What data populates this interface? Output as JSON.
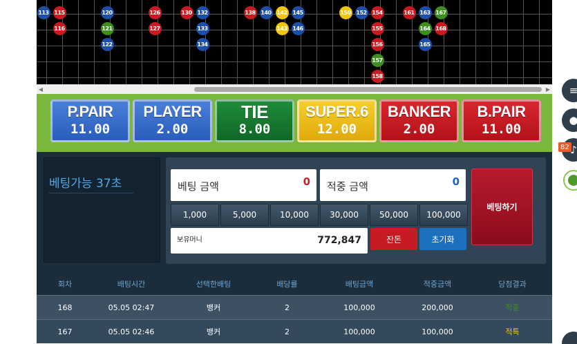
{
  "board": {
    "beads": [
      {
        "n": "113",
        "c": "B",
        "col": 0,
        "row": 0
      },
      {
        "n": "115",
        "c": "R",
        "col": 1,
        "row": 0
      },
      {
        "n": "116",
        "c": "R",
        "col": 1,
        "row": 1
      },
      {
        "n": "120",
        "c": "B",
        "col": 4,
        "row": 0
      },
      {
        "n": "121",
        "c": "G",
        "col": 4,
        "row": 1
      },
      {
        "n": "122",
        "c": "B",
        "col": 4,
        "row": 2
      },
      {
        "n": "126",
        "c": "R",
        "col": 7,
        "row": 0
      },
      {
        "n": "127",
        "c": "R",
        "col": 7,
        "row": 1
      },
      {
        "n": "130",
        "c": "R",
        "col": 9,
        "row": 0
      },
      {
        "n": "132",
        "c": "B",
        "col": 10,
        "row": 0
      },
      {
        "n": "133",
        "c": "B",
        "col": 10,
        "row": 1
      },
      {
        "n": "134",
        "c": "B",
        "col": 10,
        "row": 2
      },
      {
        "n": "138",
        "c": "R",
        "col": 13,
        "row": 0
      },
      {
        "n": "140",
        "c": "B",
        "col": 14,
        "row": 0
      },
      {
        "n": "142",
        "c": "Y",
        "col": 15,
        "row": 0
      },
      {
        "n": "143",
        "c": "Y",
        "col": 15,
        "row": 1
      },
      {
        "n": "145",
        "c": "B",
        "col": 16,
        "row": 0
      },
      {
        "n": "146",
        "c": "B",
        "col": 16,
        "row": 1
      },
      {
        "n": "150",
        "c": "Y",
        "col": 19,
        "row": 0
      },
      {
        "n": "152",
        "c": "B",
        "col": 20,
        "row": 0
      },
      {
        "n": "154",
        "c": "R",
        "col": 21,
        "row": 0
      },
      {
        "n": "155",
        "c": "R",
        "col": 21,
        "row": 1
      },
      {
        "n": "156",
        "c": "R",
        "col": 21,
        "row": 2
      },
      {
        "n": "157",
        "c": "G",
        "col": 21,
        "row": 3
      },
      {
        "n": "158",
        "c": "R",
        "col": 21,
        "row": 4
      },
      {
        "n": "161",
        "c": "R",
        "col": 23,
        "row": 0
      },
      {
        "n": "163",
        "c": "B",
        "col": 24,
        "row": 0
      },
      {
        "n": "164",
        "c": "G",
        "col": 24,
        "row": 1
      },
      {
        "n": "165",
        "c": "B",
        "col": 24,
        "row": 2
      },
      {
        "n": "167",
        "c": "G",
        "col": 25,
        "row": 0
      },
      {
        "n": "168",
        "c": "R",
        "col": 25,
        "row": 1
      }
    ]
  },
  "options": [
    {
      "name": "P.PAIR",
      "odds": "11.00",
      "style": "blue"
    },
    {
      "name": "PLAYER",
      "odds": "2.00",
      "style": "blue"
    },
    {
      "name": "TIE",
      "odds": "8.00",
      "style": "green"
    },
    {
      "name": "SUPER.6",
      "odds": "12.00",
      "style": "yellow"
    },
    {
      "name": "BANKER",
      "odds": "2.00",
      "style": "red"
    },
    {
      "name": "B.PAIR",
      "odds": "11.00",
      "style": "red"
    }
  ],
  "panel": {
    "timer": "베팅가능 37초",
    "bet_amount_label": "베팅 금액",
    "bet_amount_value": "0",
    "win_amount_label": "적중 금액",
    "win_amount_value": "0",
    "chips": [
      "1,000",
      "5,000",
      "10,000",
      "30,000",
      "50,000",
      "100,000"
    ],
    "balance_label": "보유머니",
    "balance_value": "772,847",
    "change_label": "잔돈",
    "reset_label": "초기화",
    "bet_button": "베팅하기"
  },
  "table": {
    "headers": [
      "회차",
      "배팅시간",
      "선택한배팅",
      "배당률",
      "배팅금액",
      "적중금액",
      "당첨결과"
    ],
    "rows": [
      {
        "round": "168",
        "time": "05.05 02:47",
        "pick": "뱅커",
        "odds": "2",
        "bet": "100,000",
        "win": "200,000",
        "result": "적중",
        "hit": true
      },
      {
        "round": "167",
        "time": "05.05 02:46",
        "pick": "뱅커",
        "odds": "2",
        "bet": "100,000",
        "win": "100,000",
        "result": "적특",
        "hit": false
      }
    ]
  },
  "side": {
    "badge": "82"
  },
  "colors": {
    "board_bg": "#000000",
    "option_bar": "#79b83a",
    "panel_bg": "#1b2c3a",
    "bet_button": "#b71a2e"
  }
}
